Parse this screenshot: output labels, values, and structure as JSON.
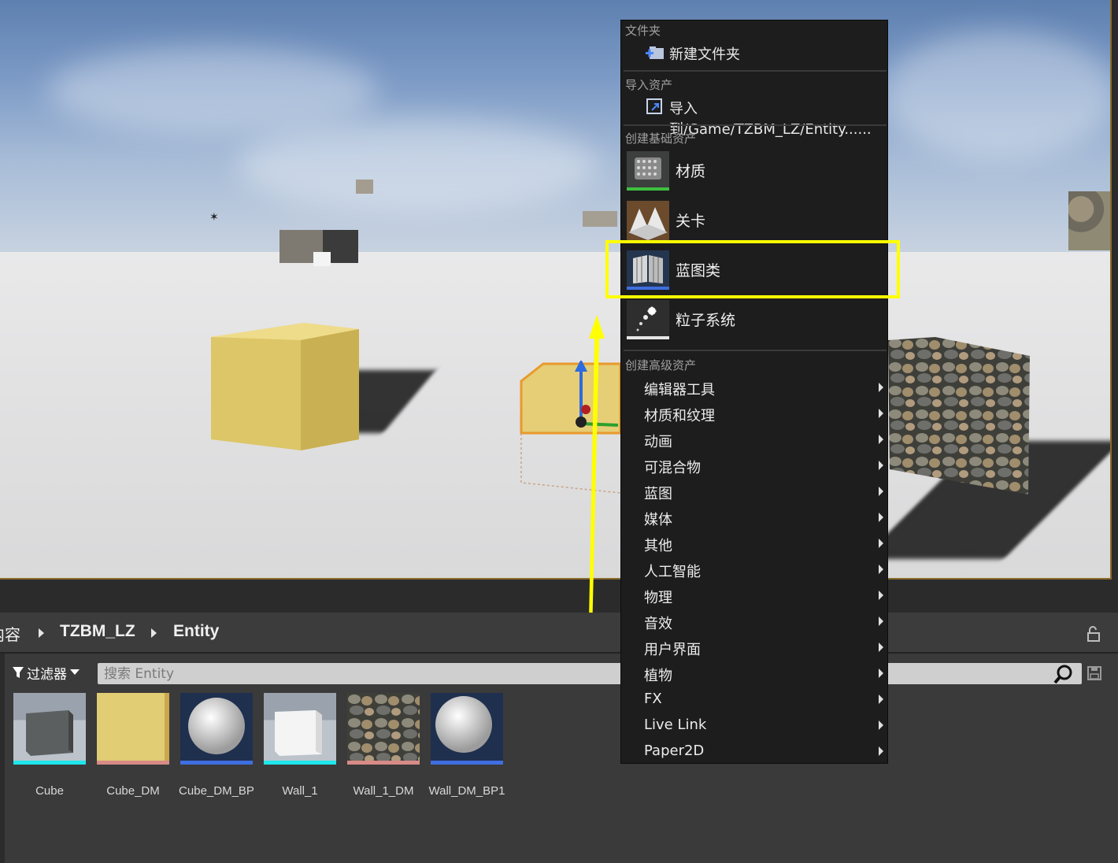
{
  "menu": {
    "folder_section": "文件夹",
    "new_folder": "新建文件夹",
    "import_section": "导入资产",
    "import_to": "导入到/Game/TZBM_LZ/Entity......",
    "basic_section": "创建基础资产",
    "basic_items": [
      "材质",
      "关卡",
      "蓝图类",
      "粒子系统"
    ],
    "advanced_section": "创建高级资产",
    "advanced_items": [
      "编辑器工具",
      "材质和纹理",
      "动画",
      "可混合物",
      "蓝图",
      "媒体",
      "其他",
      "人工智能",
      "物理",
      "音效",
      "用户界面",
      "植物",
      "FX",
      "Live Link",
      "Paper2D"
    ]
  },
  "breadcrumb": {
    "root_partial": "内容",
    "folder1": "TZBM_LZ",
    "folder2": "Entity"
  },
  "toolbar": {
    "filter_label": "过滤器",
    "search_placeholder": "搜索 Entity"
  },
  "assets": [
    {
      "name": "Cube",
      "bar_color": "#1fe6ea"
    },
    {
      "name": "Cube_DM",
      "bar_color": "#d88b86"
    },
    {
      "name": "Cube_DM_BP",
      "bar_color": "#3f6ee0"
    },
    {
      "name": "Wall_1",
      "bar_color": "#1fe6ea"
    },
    {
      "name": "Wall_1_DM",
      "bar_color": "#d88b86"
    },
    {
      "name": "Wall_DM_BP1",
      "bar_color": "#3f6ee0"
    }
  ],
  "highlight_color": "#ffff00"
}
